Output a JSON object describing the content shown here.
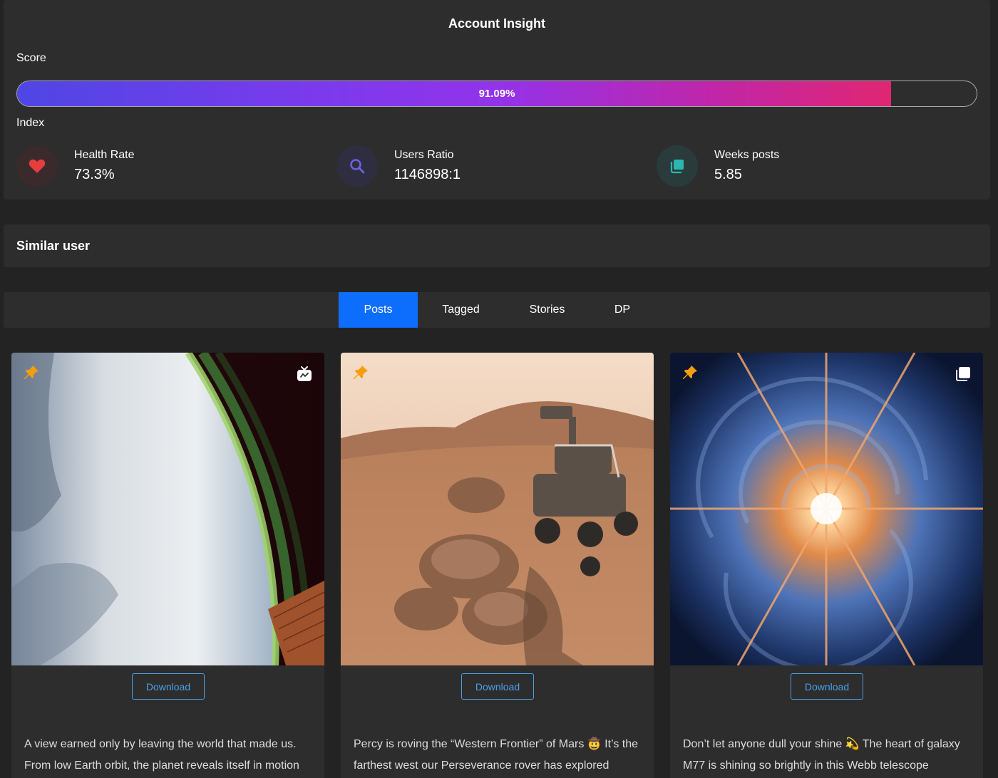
{
  "insight": {
    "title": "Account Insight",
    "score_label": "Score",
    "score_percent": 91.09,
    "score_text": "91.09%",
    "index_label": "Index",
    "stats": [
      {
        "icon": "heart-icon",
        "label": "Health Rate",
        "value": "73.3%",
        "color": "#e53e3e"
      },
      {
        "icon": "search-icon",
        "label": "Users Ratio",
        "value": "1146898:1",
        "color": "#6b63e0"
      },
      {
        "icon": "stack-icon",
        "label": "Weeks posts",
        "value": "5.85",
        "color": "#2bb7b0"
      }
    ]
  },
  "similar": {
    "title": "Similar user"
  },
  "tabs": [
    {
      "label": "Posts",
      "active": true
    },
    {
      "label": "Tagged",
      "active": false
    },
    {
      "label": "Stories",
      "active": false
    },
    {
      "label": "DP",
      "active": false
    }
  ],
  "posts": [
    {
      "pinned": true,
      "type_icon": "igtv-icon",
      "image": "earth-orbit-aurora",
      "download_label": "Download",
      "caption": "A view earned only by leaving the world that made us. From low Earth orbit, the planet reveals itself in motion"
    },
    {
      "pinned": true,
      "type_icon": null,
      "image": "mars-perseverance-rover",
      "download_label": "Download",
      "caption": "Percy is roving the “Western Frontier” of Mars 🤠 It’s the farthest west our Perseverance rover has explored"
    },
    {
      "pinned": true,
      "type_icon": "carousel-icon",
      "image": "galaxy-m77-webb",
      "download_label": "Download",
      "caption": "Don’t let anyone dull your shine 💫 The heart of galaxy M77 is shining so brightly in this Webb telescope"
    }
  ],
  "colors": {
    "accent": "#0d6efd",
    "download": "#4a9fe8",
    "pin": "#f59e0b",
    "progress_start": "#4f46e5",
    "progress_end": "#e02672"
  }
}
